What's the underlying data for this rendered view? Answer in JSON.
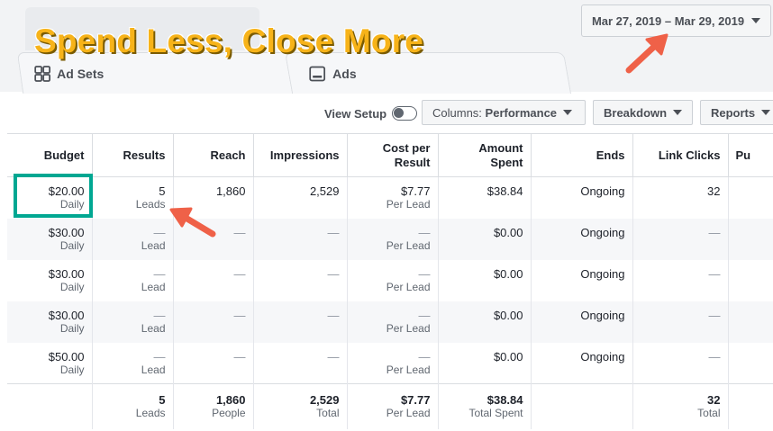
{
  "headline": "Spend Less, Close More",
  "tabs": [
    {
      "label": "Ad Sets",
      "icon": "grid-icon"
    },
    {
      "label": "Ads",
      "icon": "ad-icon"
    }
  ],
  "date_range": "Mar 27, 2019 – Mar 29, 2019",
  "toolbar": {
    "view_setup_label": "View Setup",
    "columns_prefix": "Columns:",
    "columns_value": "Performance",
    "breakdown_label": "Breakdown",
    "reports_label": "Reports"
  },
  "table": {
    "headers": [
      "Budget",
      "Results",
      "Reach",
      "Impressions",
      "Cost per\nResult",
      "Amount Spent",
      "Ends",
      "Link Clicks",
      "Pu"
    ],
    "rows": [
      {
        "budget": "$20.00",
        "budget_sub": "Daily",
        "results": "5",
        "results_sub": "Leads",
        "reach": "1,860",
        "impressions": "2,529",
        "cost": "$7.77",
        "cost_sub": "Per Lead",
        "spent": "$38.84",
        "ends": "Ongoing",
        "clicks": "32"
      },
      {
        "budget": "$30.00",
        "budget_sub": "Daily",
        "results": "—",
        "results_sub": "Lead",
        "reach": "—",
        "impressions": "—",
        "cost": "—",
        "cost_sub": "Per Lead",
        "spent": "$0.00",
        "ends": "Ongoing",
        "clicks": "—"
      },
      {
        "budget": "$30.00",
        "budget_sub": "Daily",
        "results": "—",
        "results_sub": "Lead",
        "reach": "—",
        "impressions": "—",
        "cost": "—",
        "cost_sub": "Per Lead",
        "spent": "$0.00",
        "ends": "Ongoing",
        "clicks": "—"
      },
      {
        "budget": "$30.00",
        "budget_sub": "Daily",
        "results": "—",
        "results_sub": "Lead",
        "reach": "—",
        "impressions": "—",
        "cost": "—",
        "cost_sub": "Per Lead",
        "spent": "$0.00",
        "ends": "Ongoing",
        "clicks": "—"
      },
      {
        "budget": "$50.00",
        "budget_sub": "Daily",
        "results": "—",
        "results_sub": "Lead",
        "reach": "—",
        "impressions": "—",
        "cost": "—",
        "cost_sub": "Per Lead",
        "spent": "$0.00",
        "ends": "Ongoing",
        "clicks": "—"
      }
    ],
    "summary": {
      "results": "5",
      "results_sub": "Leads",
      "reach": "1,860",
      "reach_sub": "People",
      "impressions": "2,529",
      "impressions_sub": "Total",
      "cost": "$7.77",
      "cost_sub": "Per Lead",
      "spent": "$38.84",
      "spent_sub": "Total Spent",
      "clicks": "32",
      "clicks_sub": "Total"
    }
  },
  "colors": {
    "headline": "#f7b319",
    "highlight_box": "#00a792",
    "arrow": "#ef6148"
  }
}
